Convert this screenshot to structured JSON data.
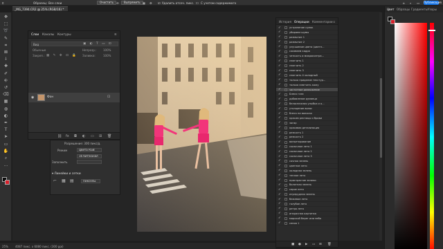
{
  "optionsbar": {
    "sample_label": "Образец:",
    "sample_value": "Все слои",
    "clear_button": "Очистить",
    "straighten_button": "Выпрямить",
    "delete_cropped_label": "Удалить отсеч. пикс.",
    "content_aware_label": "С учетом содержимого",
    "share_button": "Публикация"
  },
  "document": {
    "tab_title": "_MG_7394.CR2 @ 25% (RGB/16) *"
  },
  "tools": {
    "items": [
      "move-icon",
      "marquee-icon",
      "lasso-icon",
      "quick-select-icon",
      "crop-icon",
      "frame-icon",
      "eyedropper-icon",
      "healing-brush-icon",
      "brush-icon",
      "stamp-icon",
      "history-brush-icon",
      "eraser-icon",
      "gradient-icon",
      "blur-icon",
      "dodge-icon",
      "pen-icon",
      "type-icon",
      "path-select-icon",
      "rectangle-icon",
      "hand-icon",
      "zoom-icon",
      "more-tools-icon"
    ],
    "glyphs": [
      "✥",
      "⬚",
      "➰",
      "✎",
      "⌗",
      "⊠",
      "⸸",
      "✚",
      "✐",
      "⎆",
      "↺",
      "⌫",
      "▦",
      "◍",
      "◐",
      "✒",
      "T",
      "➤",
      "▭",
      "✋",
      "⌕",
      "…"
    ]
  },
  "colors": {
    "foreground": "#0a0a0a",
    "background": "#d8202b",
    "accent": "#1473e6"
  },
  "layers_panel": {
    "tabs": [
      "Слои",
      "Каналы",
      "Контуры"
    ],
    "active_tab": "Слои",
    "filter_placeholder": "Вид",
    "layer_name": "Фон",
    "blend_mode": "Обычные",
    "opacity_label": "Непрозр.:",
    "opacity_value": "100%",
    "lock_label": "Закреп.:",
    "fill_label": "Заливка:",
    "fill_value": "100%"
  },
  "properties_panel": {
    "resolution_label": "Разрешение: 300 пикс/д.",
    "mode_label": "Режим",
    "mode_value": "Цвета RGB",
    "bits_value": "16 бит/канал",
    "fill_label": "Заполнить",
    "rulers_section": "Линейки и сетки",
    "units_value": "Пикселы"
  },
  "history_panel": {
    "tabs": [
      "История",
      "Операции",
      "Комментарии"
    ],
    "active_tab": "Операции",
    "items": [
      "устранение сумок",
      "убираем шумы",
      "размытие 1",
      "размытие 2",
      "улучшение цвета (цветн...",
      "сжимаем кадра",
      "четкость и микроконтра...",
      "смягчить 1",
      "смягчить 2",
      "смягчить 3",
      "смягчить 4 холодный",
      "только придание текстур...",
      "только смягчить кожу",
      "частотное разложение",
      "Блеск глаз",
      "добавление румянца",
      "белоснежная улыбка и о...",
      "утолщение волос",
      "блеск на волосах",
      "красим ресницы и брови",
      "загар",
      "красивая детализация",
      "резкость 1",
      "резкость 2",
      "виньетирование",
      "сказочное лето 1",
      "сказочное лето 2",
      "сказочное лето 3",
      "сочная зелень",
      "цветное лето",
      "холодная зелень",
      "теплое лето",
      "пристрастие зелени",
      "болотная зелень",
      "серое лето",
      "изумрудная зелень",
      "бежевое лето",
      "голубое лето",
      "ретро лето",
      "инкрасная картинка",
      "морской берег или небо",
      "сепия 1"
    ],
    "selected_index": 13
  },
  "color_panel": {
    "tabs": [
      "Цвет",
      "Образцы",
      "Градиенты",
      "Узоры"
    ],
    "active_tab": "Цвет"
  },
  "statusbar": {
    "zoom": "25%",
    "doc_info": "4087 пикс. х 6080 пикс. (300 ppi)"
  }
}
